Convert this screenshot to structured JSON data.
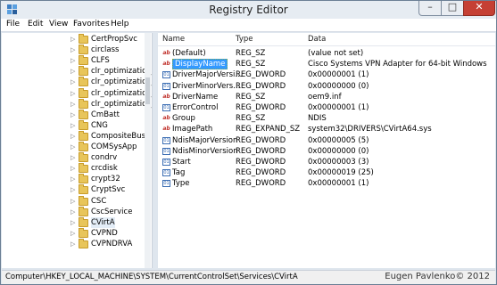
{
  "window": {
    "title": "Registry Editor"
  },
  "menubar": [
    "File",
    "Edit",
    "View",
    "Favorites",
    "Help"
  ],
  "tree": {
    "items": [
      "CertPropSvc",
      "circlass",
      "CLFS",
      "clr_optimization_",
      "clr_optimization_",
      "clr_optimization_",
      "clr_optimization_",
      "CmBatt",
      "CNG",
      "CompositeBus",
      "COMSysApp",
      "condrv",
      "crcdisk",
      "crypt32",
      "CryptSvc",
      "CSC",
      "CscService",
      "CVirtA",
      "CVPND",
      "CVPNDRVA"
    ],
    "selected_index": 17
  },
  "list": {
    "columns": {
      "name": "Name",
      "type": "Type",
      "data": "Data"
    },
    "rows": [
      {
        "icon": "string-value-icon",
        "name": "(Default)",
        "type": "REG_SZ",
        "data": "(value not set)"
      },
      {
        "icon": "string-value-icon",
        "name": "DisplayName",
        "type": "REG_SZ",
        "data": "Cisco Systems VPN Adapter for 64-bit Windows",
        "selected": true
      },
      {
        "icon": "binary-value-icon",
        "name": "DriverMajorVersi...",
        "type": "REG_DWORD",
        "data": "0x00000001 (1)"
      },
      {
        "icon": "binary-value-icon",
        "name": "DriverMinorVers...",
        "type": "REG_DWORD",
        "data": "0x00000000 (0)"
      },
      {
        "icon": "string-value-icon",
        "name": "DriverName",
        "type": "REG_SZ",
        "data": "oem9.inf"
      },
      {
        "icon": "binary-value-icon",
        "name": "ErrorControl",
        "type": "REG_DWORD",
        "data": "0x00000001 (1)"
      },
      {
        "icon": "string-value-icon",
        "name": "Group",
        "type": "REG_SZ",
        "data": "NDIS"
      },
      {
        "icon": "string-value-icon",
        "name": "ImagePath",
        "type": "REG_EXPAND_SZ",
        "data": "system32\\DRIVERS\\CVirtA64.sys"
      },
      {
        "icon": "binary-value-icon",
        "name": "NdisMajorVersion",
        "type": "REG_DWORD",
        "data": "0x00000005 (5)"
      },
      {
        "icon": "binary-value-icon",
        "name": "NdisMinorVersion",
        "type": "REG_DWORD",
        "data": "0x00000000 (0)"
      },
      {
        "icon": "binary-value-icon",
        "name": "Start",
        "type": "REG_DWORD",
        "data": "0x00000003 (3)"
      },
      {
        "icon": "binary-value-icon",
        "name": "Tag",
        "type": "REG_DWORD",
        "data": "0x00000019 (25)"
      },
      {
        "icon": "binary-value-icon",
        "name": "Type",
        "type": "REG_DWORD",
        "data": "0x00000001 (1)"
      }
    ]
  },
  "status": {
    "path": "Computer\\HKEY_LOCAL_MACHINE\\SYSTEM\\CurrentControlSet\\Services\\CVirtA"
  },
  "credit": "Eugen Pavlenko© 2012",
  "colors": {
    "selection": "#3399ff",
    "close_button": "#c54034"
  }
}
